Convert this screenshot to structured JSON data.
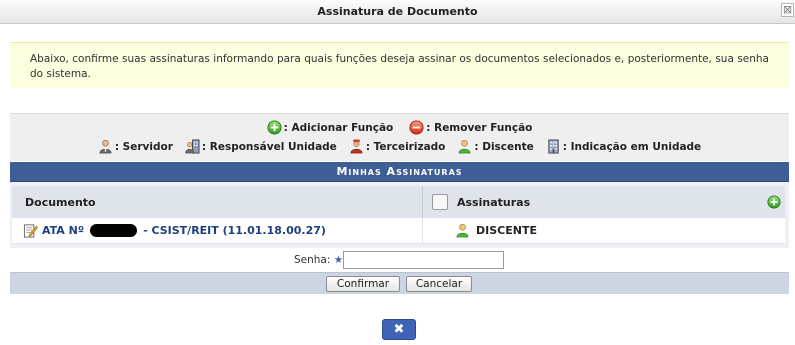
{
  "window": {
    "title": "Assinatura de Documento",
    "close_glyph": "⊠"
  },
  "info": {
    "text": "Abaixo, confirme suas assinaturas informando para quais funções deseja assinar os documentos selecionados e, posteriormente, sua senha do sistema."
  },
  "legend": {
    "add": {
      "label": ": Adicionar Função",
      "icon": "plus-circle-icon"
    },
    "remove": {
      "label": ": Remover Função",
      "icon": "minus-circle-icon"
    },
    "items": [
      {
        "label": ": Servidor",
        "icon": "servidor-icon"
      },
      {
        "label": ": Responsável Unidade",
        "icon": "responsavel-unidade-icon"
      },
      {
        "label": ": Terceirizado",
        "icon": "terceirizado-icon"
      },
      {
        "label": ": Discente",
        "icon": "discente-icon"
      },
      {
        "label": ": Indicação em Unidade",
        "icon": "indicacao-unidade-icon"
      }
    ]
  },
  "panel": {
    "title": "Minhas Assinaturas",
    "columns": {
      "document": "Documento",
      "signatures": "Assinaturas"
    },
    "rows": [
      {
        "doc_prefix": "ATA Nº",
        "doc_suffix": "- CSIST/REIT (11.01.18.00.27)",
        "signature": "DISCENTE"
      }
    ]
  },
  "password": {
    "label": "Senha:",
    "required_mark": "★",
    "value": ""
  },
  "buttons": {
    "confirm": "Confirmar",
    "cancel": "Cancelar",
    "close_glyph": "✖"
  },
  "colors": {
    "header_blue": "#3f5e95",
    "info_yellow": "#fdfde0",
    "link_blue": "#1f3f80",
    "button_blue": "#3f63b5"
  }
}
